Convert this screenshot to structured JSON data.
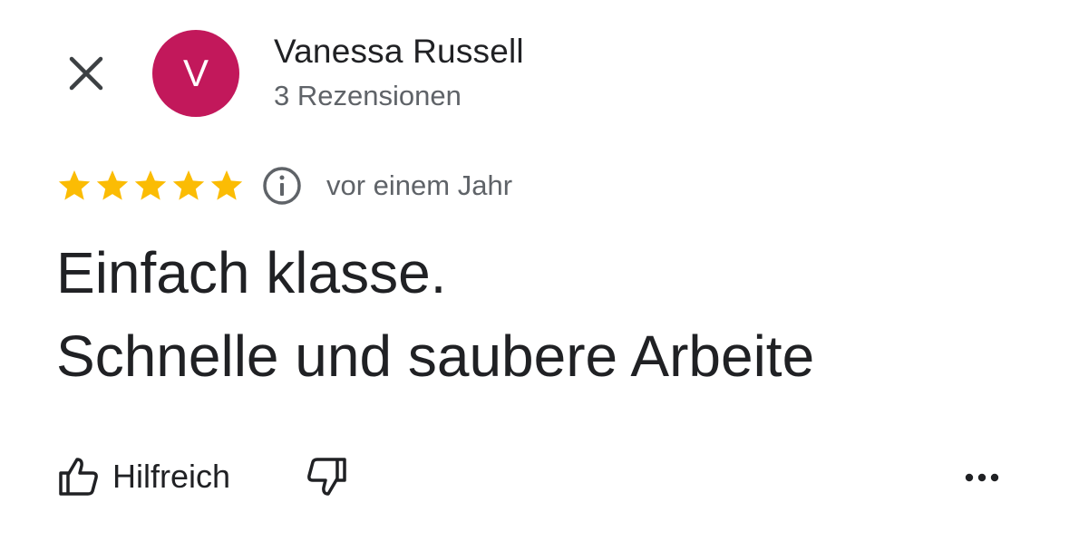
{
  "header": {
    "close_icon": "close-icon",
    "avatar_letter": "V",
    "avatar_color": "#c2185b",
    "reviewer_name": "Vanessa Russell",
    "reviews_count": "3 Rezensionen"
  },
  "review": {
    "rating": 5,
    "rating_max": 5,
    "star_color": "#fbbc04",
    "info_icon": "info-icon",
    "date": "vor einem Jahr",
    "lines": [
      "Einfach klasse.",
      "Schnelle und saubere Arbeite"
    ]
  },
  "actions": {
    "helpful_label": "Hilfreich",
    "helpful_icon": "thumb-up-icon",
    "not_helpful_icon": "thumb-down-icon",
    "more_icon": "more-horizontal-icon"
  }
}
